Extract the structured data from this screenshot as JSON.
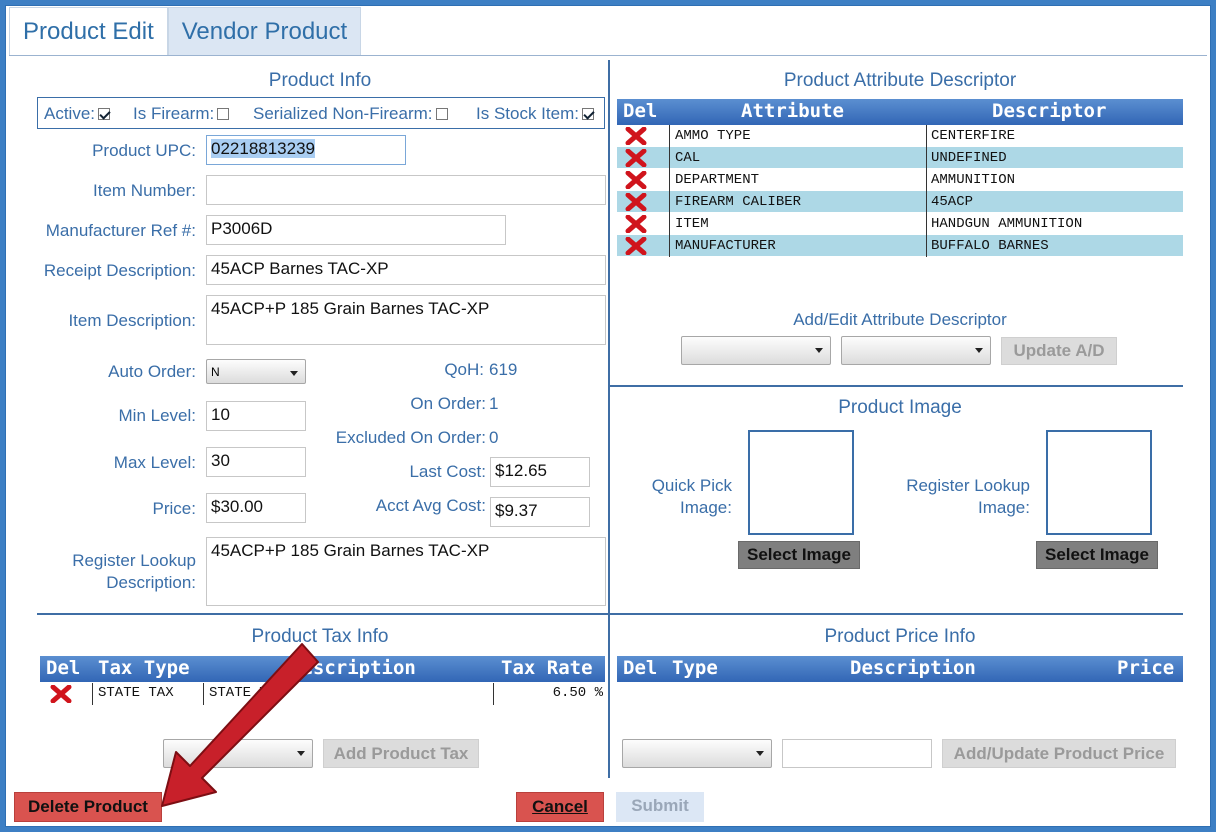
{
  "tabs": [
    {
      "label": "Product Edit"
    },
    {
      "label": "Vendor Product"
    }
  ],
  "product_info": {
    "title": "Product Info",
    "flags": {
      "active": "Active:",
      "is_firearm": "Is Firearm:",
      "serialized": "Serialized Non-Firearm:",
      "stock_item": "Is Stock Item:"
    },
    "flag_values": {
      "active": true,
      "is_firearm": false,
      "serialized": false,
      "stock_item": true
    },
    "upc_label": "Product UPC:",
    "upc": "02218813239",
    "item_number_label": "Item Number:",
    "item_number": "",
    "mfr_ref_label": "Manufacturer Ref #:",
    "mfr_ref": "P3006D",
    "receipt_desc_label": "Receipt Description:",
    "receipt_desc": "45ACP Barnes TAC-XP",
    "item_desc_label": "Item Description:",
    "item_desc": "45ACP+P 185 Grain Barnes TAC-XP",
    "auto_order_label": "Auto Order:",
    "auto_order": "N",
    "min_level_label": "Min Level:",
    "min_level": "10",
    "max_level_label": "Max Level:",
    "max_level": "30",
    "price_label": "Price:",
    "price": "$30.00",
    "qoh_label": "QoH:",
    "qoh": "619",
    "on_order_label": "On Order:",
    "on_order": "1",
    "excluded_label": "Excluded On Order:",
    "excluded": "0",
    "last_cost_label": "Last Cost:",
    "last_cost": "$12.65",
    "avg_cost_label": "Acct Avg Cost:",
    "avg_cost": "$9.37",
    "reg_lookup_label1": "Register Lookup",
    "reg_lookup_label2": "Description:",
    "reg_lookup": "45ACP+P 185 Grain Barnes TAC-XP"
  },
  "attributes": {
    "title": "Product Attribute Descriptor",
    "headers": {
      "del": "Del",
      "attribute": "Attribute",
      "descriptor": "Descriptor"
    },
    "rows": [
      {
        "attribute": "AMMO TYPE",
        "descriptor": "CENTERFIRE"
      },
      {
        "attribute": "CAL",
        "descriptor": "UNDEFINED"
      },
      {
        "attribute": "DEPARTMENT",
        "descriptor": "AMMUNITION"
      },
      {
        "attribute": "FIREARM CALIBER",
        "descriptor": "45ACP"
      },
      {
        "attribute": "ITEM",
        "descriptor": "HANDGUN AMMUNITION"
      },
      {
        "attribute": "MANUFACTURER",
        "descriptor": "BUFFALO BARNES"
      }
    ],
    "add_edit_title": "Add/Edit Attribute Descriptor",
    "update_button": "Update A/D"
  },
  "image": {
    "title": "Product Image",
    "quick_pick_1": "Quick Pick",
    "quick_pick_2": "Image:",
    "reg_lookup_1": "Register Lookup",
    "reg_lookup_2": "Image:",
    "select_button": "Select Image"
  },
  "tax": {
    "title": "Product Tax Info",
    "headers": {
      "del": "Del",
      "type": "Tax Type",
      "desc": "Description",
      "rate": "Tax Rate"
    },
    "rows": [
      {
        "type": "STATE TAX",
        "desc": "STATE TAX",
        "rate": "6.50 %"
      }
    ],
    "add_button": "Add Product Tax"
  },
  "price_info": {
    "title": "Product Price Info",
    "headers": {
      "del": "Del",
      "type": "Type",
      "desc": "Description",
      "price": "Price"
    },
    "add_button": "Add/Update Product Price"
  },
  "footer": {
    "delete": "Delete Product",
    "cancel": "Cancel",
    "submit": "Submit"
  },
  "colors": {
    "accent": "#3a6ea8",
    "header_blue": "#3266b5",
    "delete_red": "#d9534f",
    "arrow_red": "#c8202a"
  }
}
